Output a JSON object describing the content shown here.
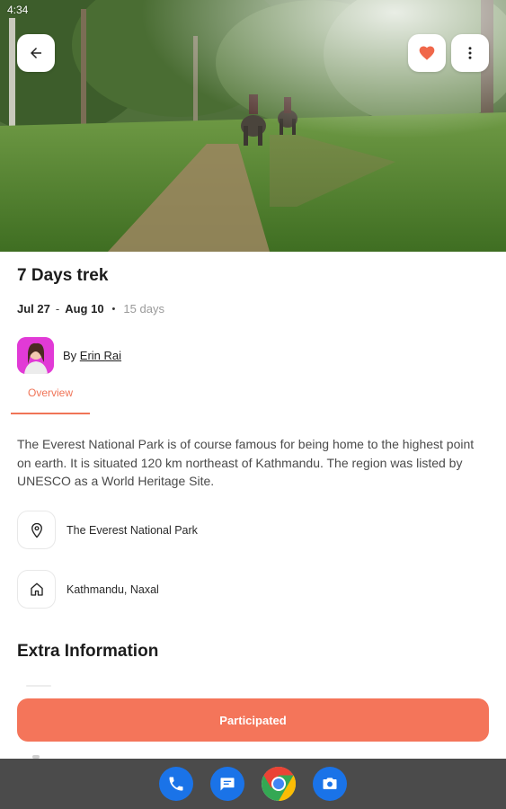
{
  "status_bar": {
    "time": "4:34"
  },
  "trip": {
    "title": "7 Days trek",
    "start_date": "Jul 27",
    "date_separator": "-",
    "end_date": "Aug 10",
    "bullet": "•",
    "duration": "15 days"
  },
  "author": {
    "prefix": "By",
    "name": "Erin Rai"
  },
  "tabs": [
    {
      "label": "Overview",
      "active": true
    }
  ],
  "overview": {
    "description": "The Everest National Park is of course famous for being home to the highest point on earth. It is situated 120 km northeast of Kathmandu. The region was listed by UNESCO as a World Heritage Site."
  },
  "details": [
    {
      "icon": "location-pin-icon",
      "text": "The Everest National Park"
    },
    {
      "icon": "home-icon",
      "text": "Kathmandu, Naxal"
    }
  ],
  "extra_section": {
    "title": "Extra Information"
  },
  "cta": {
    "label": "Participated"
  },
  "header_actions": {
    "favorite_icon": "heart-icon",
    "more_icon": "more-vertical-icon",
    "back_icon": "arrow-left-icon"
  },
  "dock": [
    {
      "name": "Phone",
      "icon": "phone-icon",
      "color": "#1a73e8"
    },
    {
      "name": "Messages",
      "icon": "messages-icon",
      "color": "#1a73e8"
    },
    {
      "name": "Chrome",
      "icon": "chrome-icon",
      "color": "#34a853"
    },
    {
      "name": "Camera",
      "icon": "camera-icon",
      "color": "#1a73e8"
    }
  ],
  "colors": {
    "accent": "#f4755a",
    "tab_accent": "#f07457",
    "favorite": "#f0674a",
    "dock_bg": "#4b4b4b"
  }
}
